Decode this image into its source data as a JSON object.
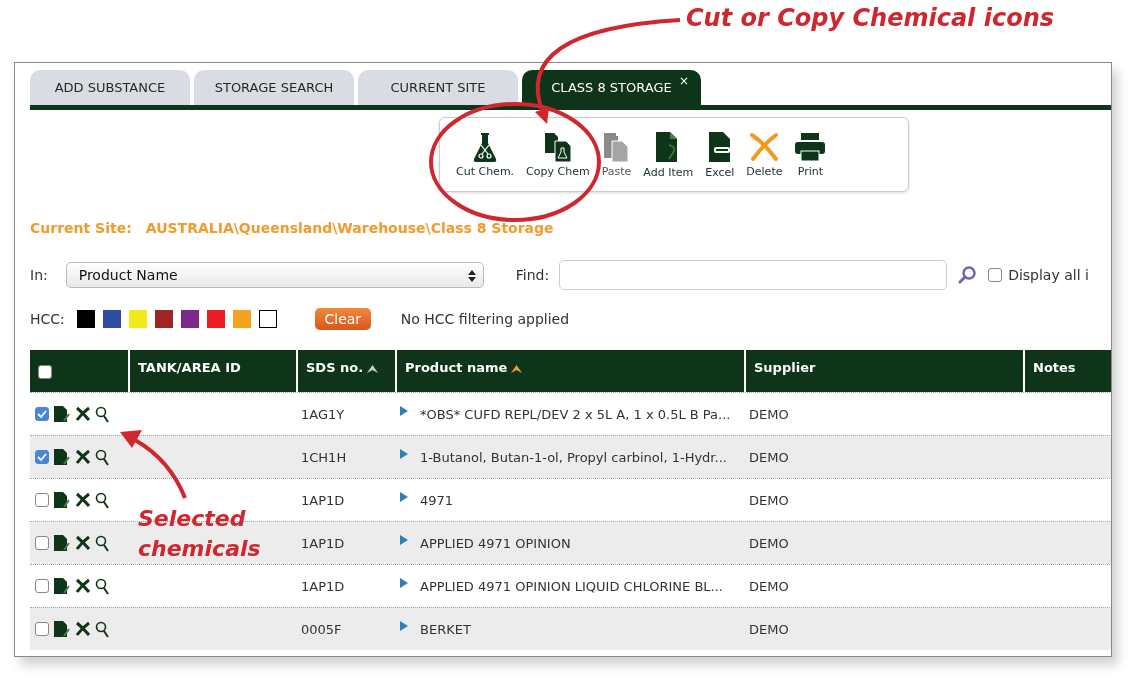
{
  "callout_top": {
    "text": "Cut or Copy Chemical icons"
  },
  "callout_rows": {
    "text": "Selected chemicals"
  },
  "tabs": [
    {
      "label": "ADD SUBSTANCE",
      "selected": false
    },
    {
      "label": "STORAGE SEARCH",
      "selected": false
    },
    {
      "label": "CURRENT SITE",
      "selected": false
    },
    {
      "label": "CLASS 8 STORAGE",
      "selected": true,
      "close": "×"
    }
  ],
  "toolbar": [
    {
      "label": "Cut Chem.",
      "kind": "cut",
      "disabled": false
    },
    {
      "label": "Copy Chem",
      "kind": "copy",
      "disabled": false
    },
    {
      "label": "Paste",
      "kind": "paste",
      "disabled": true
    },
    {
      "label": "Add Item",
      "kind": "add",
      "disabled": false
    },
    {
      "label": "Excel",
      "kind": "excel",
      "disabled": false
    },
    {
      "label": "Delete",
      "kind": "delete",
      "disabled": false
    },
    {
      "label": "Print",
      "kind": "print",
      "disabled": false
    }
  ],
  "current_site": {
    "label": "Current Site:",
    "value": "AUSTRALIA\\Queensland\\Warehouse\\Class 8 Storage"
  },
  "search": {
    "in_label": "In:",
    "in_value": "Product Name",
    "find_label": "Find:",
    "display_all": {
      "label": "Display all i",
      "checked": false
    }
  },
  "hcc": {
    "label": "HCC:",
    "swatches": [
      {
        "color": "#000000"
      },
      {
        "color": "#2e4da3"
      },
      {
        "color": "#f2ea1a"
      },
      {
        "color": "#a02626"
      },
      {
        "color": "#7b2a8b"
      },
      {
        "color": "#ea1c24"
      },
      {
        "color": "#f4a11d"
      },
      {
        "color": "#ffffff"
      }
    ],
    "clear": "Clear",
    "status": "No HCC filtering applied"
  },
  "table": {
    "select_all": false,
    "columns": [
      {
        "label": "TANK/AREA ID",
        "sorted": false
      },
      {
        "label": "SDS no.",
        "sorted": true,
        "color": "#c9d0c9"
      },
      {
        "label": "Product name",
        "sorted": true,
        "color": "#f39a2b"
      },
      {
        "label": "Supplier",
        "sorted": false
      },
      {
        "label": "Notes",
        "sorted": false
      }
    ],
    "rows": [
      {
        "checked": true,
        "sds": "1AG1Y",
        "product": "*OBS* CUFD REPL/DEV 2 x 5L A, 1 x 0.5L B Pa...",
        "supplier": "DEMO"
      },
      {
        "checked": true,
        "sds": "1CH1H",
        "product": "1-Butanol, Butan-1-ol, Propyl carbinol, 1-Hydr...",
        "supplier": "DEMO"
      },
      {
        "checked": false,
        "sds": "1AP1D",
        "product": "4971",
        "supplier": "DEMO"
      },
      {
        "checked": false,
        "sds": "1AP1D",
        "product": "APPLIED 4971 OPINION",
        "supplier": "DEMO"
      },
      {
        "checked": false,
        "sds": "1AP1D",
        "product": "APPLIED 4971 OPINION LIQUID CHLORINE BL...",
        "supplier": "DEMO"
      },
      {
        "checked": false,
        "sds": "0005F",
        "product": "BERKET",
        "supplier": "DEMO"
      }
    ]
  }
}
